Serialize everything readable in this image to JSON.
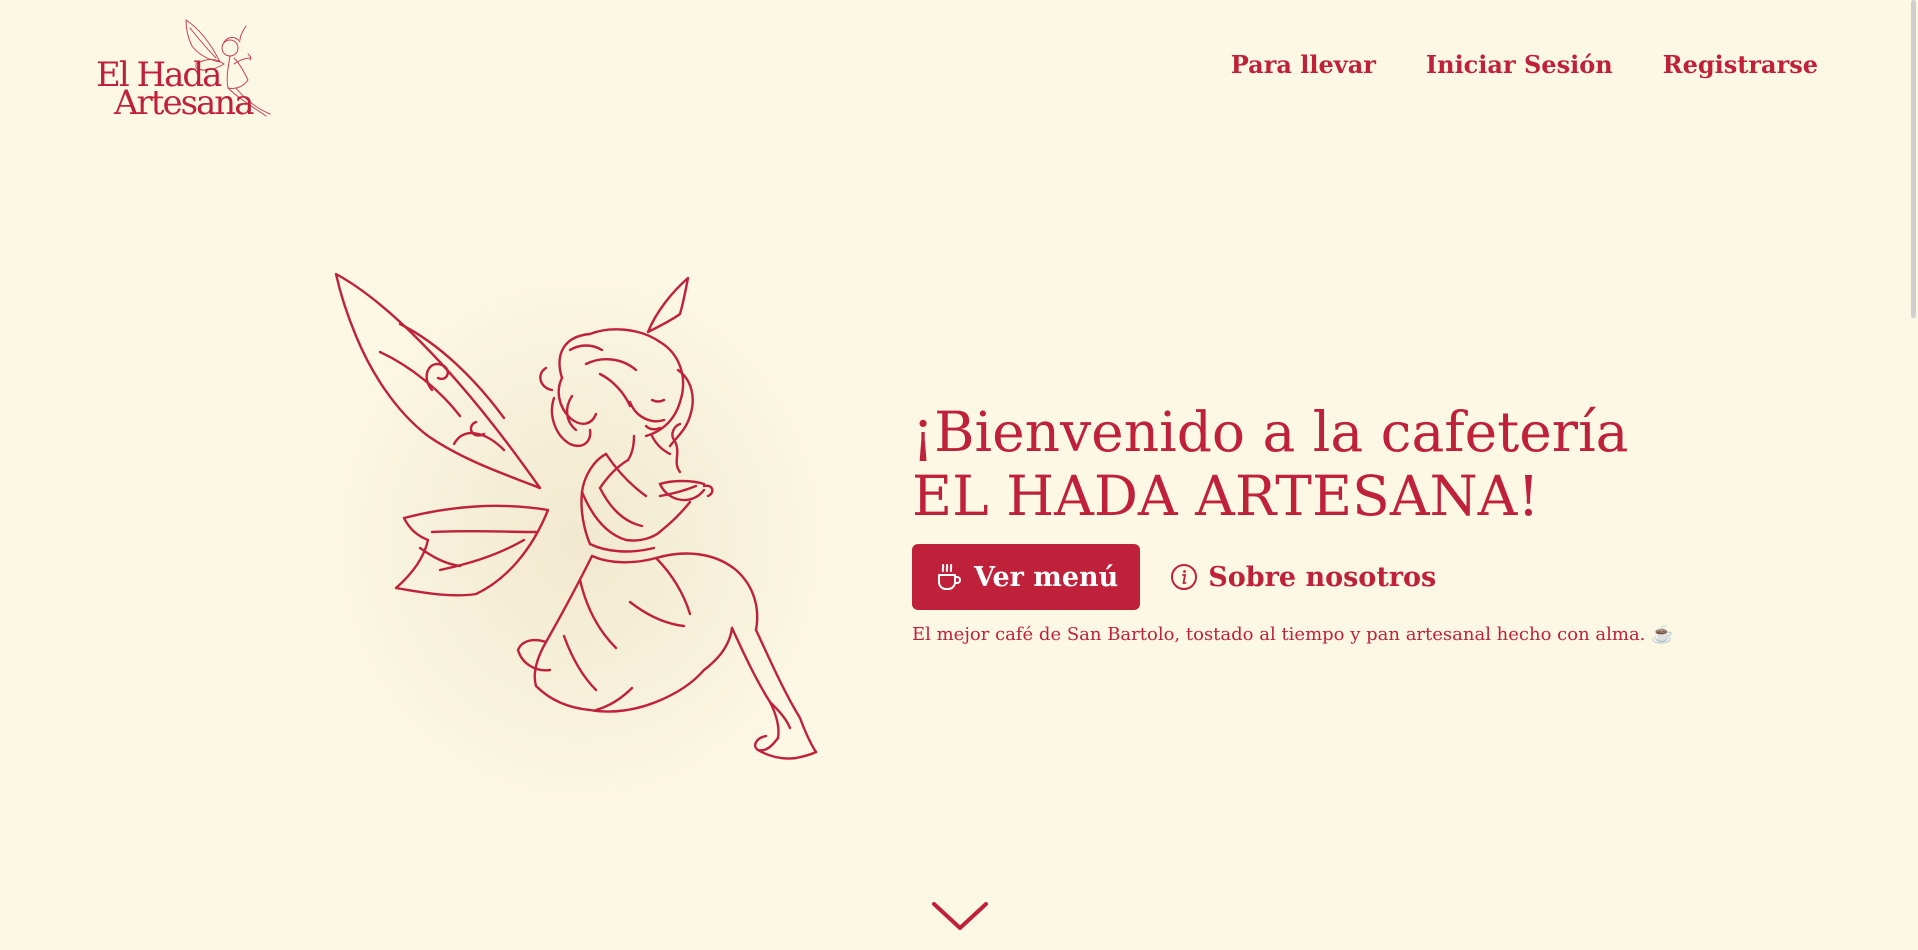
{
  "brand": {
    "logo_line1": "El Hada",
    "logo_line2": "Artesana",
    "accent_color": "#c0213a",
    "background_color": "#fdf8e4"
  },
  "nav": {
    "items": [
      {
        "label": "Para llevar"
      },
      {
        "label": "Iniciar Sesión"
      },
      {
        "label": "Registrarse"
      }
    ]
  },
  "hero": {
    "title_line1": "¡Bienvenido a la cafetería",
    "title_line2": "EL HADA ARTESANA!",
    "menu_button": {
      "label": "Ver menú",
      "icon": "coffee-cup-icon"
    },
    "about_button": {
      "label": "Sobre nosotros",
      "icon": "info-circle-icon"
    },
    "tagline": "El mejor café de San Bartolo, tostado al tiempo y pan artesanal hecho con alma. ☕",
    "illustration": "fairy-with-coffee-cup"
  },
  "scroll_indicator": {
    "icon": "chevron-down-icon"
  }
}
